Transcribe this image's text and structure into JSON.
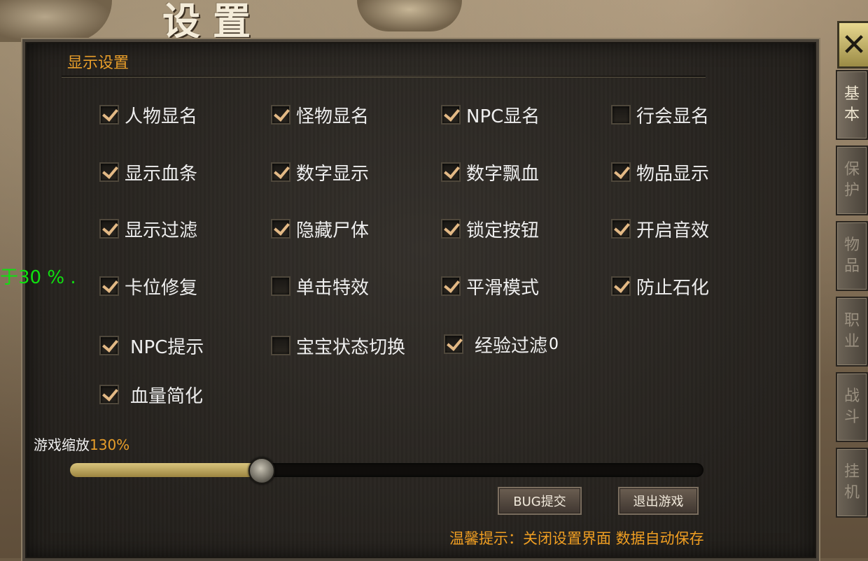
{
  "window": {
    "title": "设置",
    "close_glyph": "✕"
  },
  "overlay_text": "于30 % .",
  "display_settings": {
    "section_title": "显示设置",
    "options": [
      {
        "label": "人物显名",
        "checked": true
      },
      {
        "label": "怪物显名",
        "checked": true
      },
      {
        "label": "NPC显名",
        "checked": true
      },
      {
        "label": "行会显名",
        "checked": false
      },
      {
        "label": "显示血条",
        "checked": true
      },
      {
        "label": "数字显示",
        "checked": true
      },
      {
        "label": "数字飘血",
        "checked": true
      },
      {
        "label": "物品显示",
        "checked": true
      },
      {
        "label": "显示过滤",
        "checked": true
      },
      {
        "label": "隐藏尸体",
        "checked": true
      },
      {
        "label": "锁定按钮",
        "checked": true
      },
      {
        "label": "开启音效",
        "checked": true
      },
      {
        "label": "卡位修复",
        "checked": true
      },
      {
        "label": "单击特效",
        "checked": false
      },
      {
        "label": "平滑模式",
        "checked": true
      },
      {
        "label": "防止石化",
        "checked": true
      },
      {
        "label": "NPC提示",
        "checked": true
      },
      {
        "label": "宝宝状态切换",
        "checked": false
      },
      {
        "label": "经验过滤",
        "checked": true,
        "extra_value": "0"
      },
      {
        "label": "血量简化",
        "checked": true
      }
    ]
  },
  "zoom": {
    "label": "游戏缩放",
    "value_text": "130%",
    "slider_fraction": 0.3
  },
  "buttons": {
    "bug_submit": "BUG提交",
    "exit_game": "退出游戏"
  },
  "tip": "温馨提示：关闭设置界面 数据自动保存",
  "tabs": [
    {
      "label_lines": [
        "基",
        "本"
      ],
      "active": true
    },
    {
      "label_lines": [
        "保",
        "护"
      ],
      "active": false
    },
    {
      "label_lines": [
        "物",
        "品"
      ],
      "active": false
    },
    {
      "label_lines": [
        "职",
        "业"
      ],
      "active": false
    },
    {
      "label_lines": [
        "战",
        "斗"
      ],
      "active": false
    },
    {
      "label_lines": [
        "挂",
        "机"
      ],
      "active": false
    }
  ],
  "colors": {
    "accent_orange": "#e89e2a",
    "overlay_green": "#10e010",
    "check_color": "#e3b985"
  }
}
